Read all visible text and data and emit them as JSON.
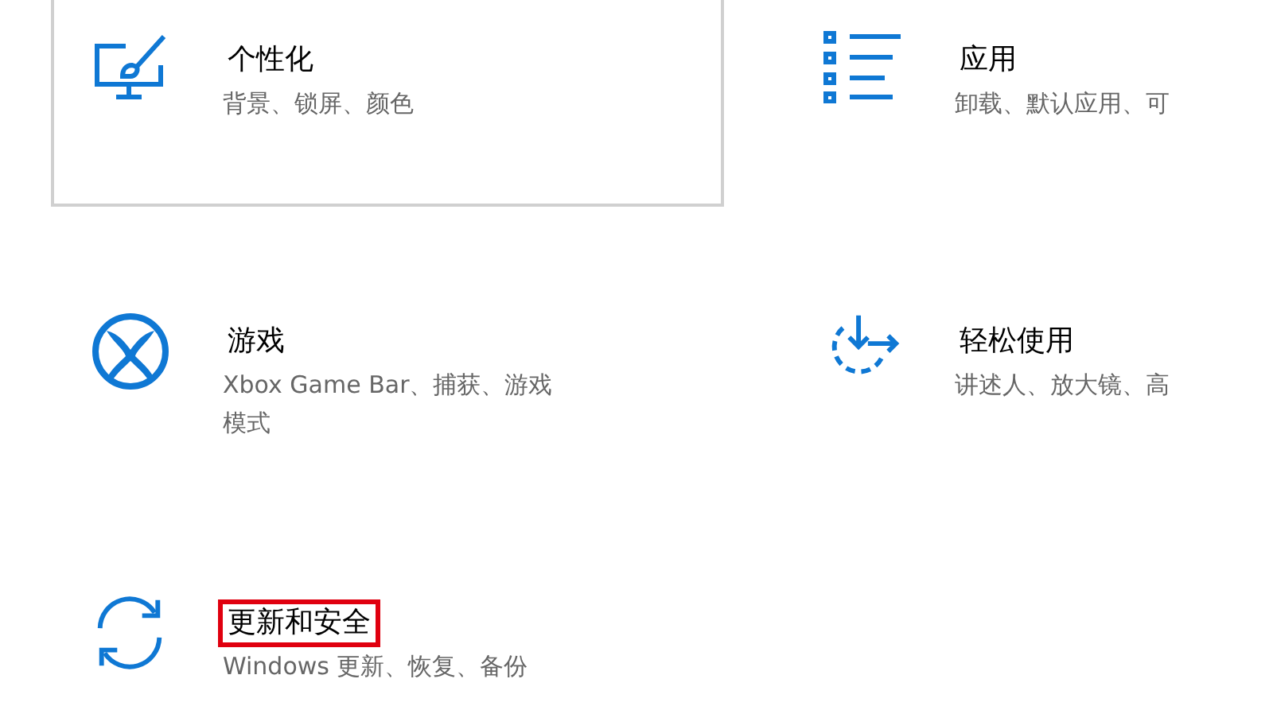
{
  "tiles": [
    {
      "kind": "personalize",
      "title": "个性化",
      "description": "背景、锁屏、颜色",
      "hovered": true,
      "highlighted": false
    },
    {
      "kind": "apps",
      "title": "应用",
      "description": "卸载、默认应用、可",
      "hovered": false,
      "highlighted": false
    },
    {
      "kind": "gaming",
      "title": "游戏",
      "description": "Xbox Game Bar、捕获、游戏模式",
      "hovered": false,
      "highlighted": false
    },
    {
      "kind": "ease",
      "title": "轻松使用",
      "description": "讲述人、放大镜、高",
      "hovered": false,
      "highlighted": false
    },
    {
      "kind": "update",
      "title": "更新和安全",
      "description": "Windows 更新、恢复、备份",
      "hovered": false,
      "highlighted": true
    }
  ]
}
